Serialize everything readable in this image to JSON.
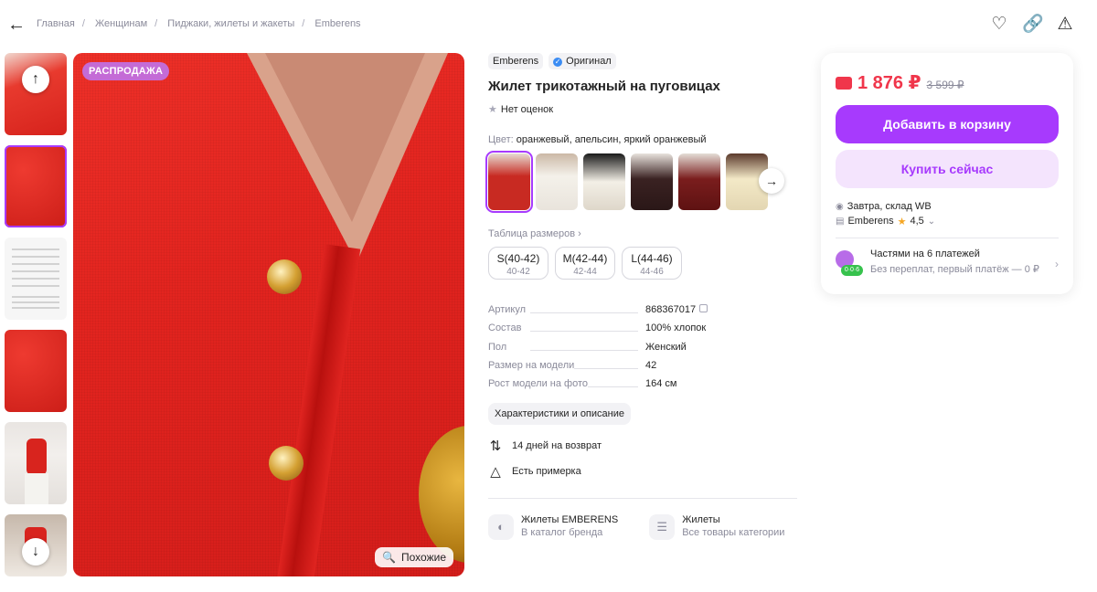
{
  "breadcrumbs": [
    "Главная",
    "Женщинам",
    "Пиджаки, жилеты и жакеты",
    "Emberens"
  ],
  "gallery": {
    "sale_badge": "РАСПРОДАЖА",
    "similar_label": "Похожие"
  },
  "product": {
    "brand": "Emberens",
    "original_label": "Оригинал",
    "title": "Жилет трикотажный на пуговицах",
    "rating_text": "Нет оценок",
    "color_label": "Цвет:",
    "color_value": "оранжевый, апельсин, яркий оранжевый",
    "size_table_label": "Таблица размеров",
    "sizes": [
      {
        "main": "S(40-42)",
        "sub": "40-42"
      },
      {
        "main": "M(42-44)",
        "sub": "42-44"
      },
      {
        "main": "L(44-46)",
        "sub": "44-46"
      }
    ],
    "specs": [
      {
        "k": "Артикул",
        "v": "868367017"
      },
      {
        "k": "Состав",
        "v": "100% хлопок"
      },
      {
        "k": "Пол",
        "v": "Женский"
      },
      {
        "k": "Размер на модели",
        "v": "42"
      },
      {
        "k": "Рост модели на фото",
        "v": "164 см"
      }
    ],
    "desc_button": "Характеристики и описание",
    "features": [
      {
        "icon": "return-icon",
        "text": "14 дней на возврат"
      },
      {
        "icon": "hanger-icon",
        "text": "Есть примерка"
      }
    ],
    "links": [
      {
        "icon": "tag-icon",
        "title": "Жилеты EMBERENS",
        "sub": "В каталог бренда"
      },
      {
        "icon": "layers-icon",
        "title": "Жилеты",
        "sub": "Все товары категории"
      }
    ]
  },
  "buy": {
    "price": "1 876 ₽",
    "old_price": "3 599 ₽",
    "add_to_cart": "Добавить в корзину",
    "buy_now": "Купить сейчас",
    "delivery": "Завтра, склад WB",
    "seller": "Emberens",
    "seller_rating": "4,5",
    "installments_title": "Частями на 6 платежей",
    "installments_sub": "Без переплат, первый платёж — 0 ₽",
    "installments_badge": "0·0·6"
  },
  "colors": {
    "accent": "#a73afd",
    "price": "#f0364b"
  }
}
